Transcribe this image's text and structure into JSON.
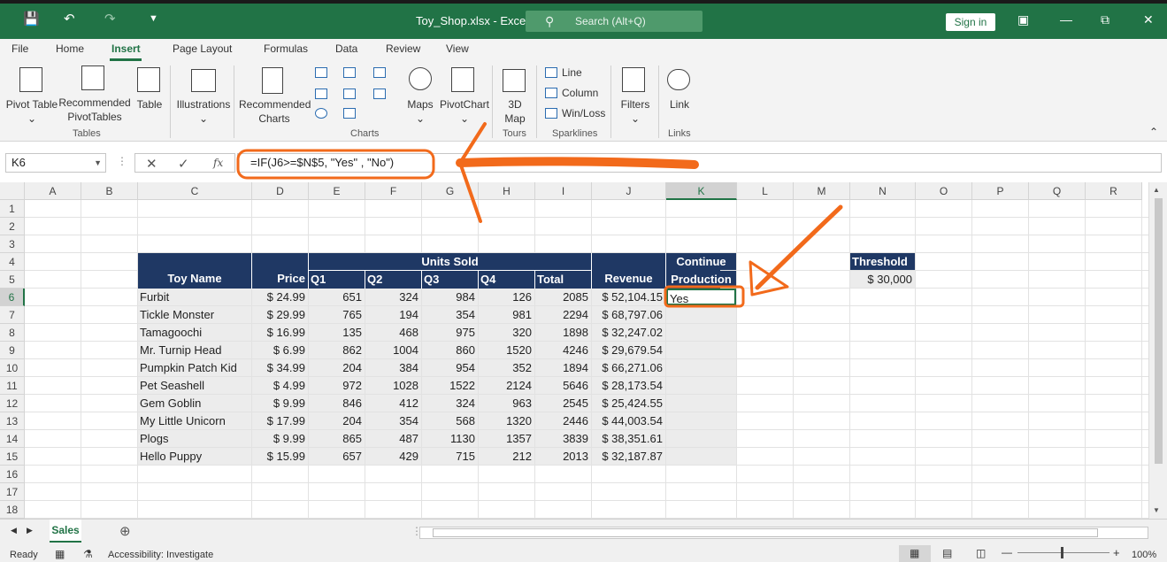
{
  "window": {
    "title": "Toy_Shop.xlsx - Excel",
    "search_placeholder": "Search (Alt+Q)",
    "signin": "Sign in"
  },
  "tabs": [
    "File",
    "Home",
    "Insert",
    "Page Layout",
    "Formulas",
    "Data",
    "Review",
    "View"
  ],
  "active_tab": "Insert",
  "ribbon": {
    "pivot_table": "Pivot Table",
    "recommended_pivot_1": "Recommended",
    "recommended_pivot_2": "PivotTables",
    "table": "Table",
    "group_tables": "Tables",
    "illustrations": "Illustrations",
    "recommended_charts_1": "Recommended",
    "recommended_charts_2": "Charts",
    "maps": "Maps",
    "pivotchart": "PivotChart",
    "group_charts": "Charts",
    "map3d_1": "3D",
    "map3d_2": "Map",
    "group_tours": "Tours",
    "spark_line": "Line",
    "spark_column": "Column",
    "spark_winloss": "Win/Loss",
    "group_sparklines": "Sparklines",
    "filters": "Filters",
    "link": "Link",
    "group_links": "Links"
  },
  "formula_bar": {
    "name_box": "K6",
    "formula": "=IF(J6>=$N$5, \"Yes\" , \"No\")"
  },
  "columns": [
    "A",
    "B",
    "C",
    "D",
    "E",
    "F",
    "G",
    "H",
    "I",
    "J",
    "K",
    "L",
    "M",
    "N",
    "O",
    "P",
    "Q",
    "R"
  ],
  "rows": [
    "1",
    "2",
    "3",
    "4",
    "5",
    "6",
    "7",
    "8",
    "9",
    "10",
    "11",
    "12",
    "13",
    "14",
    "15",
    "16",
    "17",
    "18"
  ],
  "selected_col": "K",
  "selected_row": "6",
  "table": {
    "h_toy": "Toy Name",
    "h_price": "Price",
    "h_units": "Units Sold",
    "h_q1": "Q1",
    "h_q2": "Q2",
    "h_q3": "Q3",
    "h_q4": "Q4",
    "h_total": "Total",
    "h_revenue": "Revenue",
    "h_continue": "Continue",
    "h_production": "Production",
    "rows": [
      {
        "name": "Furbit",
        "price": "$ 24.99",
        "q1": "651",
        "q2": "324",
        "q3": "984",
        "q4": "126",
        "total": "2085",
        "revenue": "$ 52,104.15",
        "cont": "Yes"
      },
      {
        "name": "Tickle Monster",
        "price": "$ 29.99",
        "q1": "765",
        "q2": "194",
        "q3": "354",
        "q4": "981",
        "total": "2294",
        "revenue": "$ 68,797.06",
        "cont": ""
      },
      {
        "name": "Tamagoochi",
        "price": "$ 16.99",
        "q1": "135",
        "q2": "468",
        "q3": "975",
        "q4": "320",
        "total": "1898",
        "revenue": "$ 32,247.02",
        "cont": ""
      },
      {
        "name": "Mr. Turnip Head",
        "price": "$ 6.99",
        "q1": "862",
        "q2": "1004",
        "q3": "860",
        "q4": "1520",
        "total": "4246",
        "revenue": "$ 29,679.54",
        "cont": ""
      },
      {
        "name": "Pumpkin Patch Kid",
        "price": "$ 34.99",
        "q1": "204",
        "q2": "384",
        "q3": "954",
        "q4": "352",
        "total": "1894",
        "revenue": "$ 66,271.06",
        "cont": ""
      },
      {
        "name": "Pet Seashell",
        "price": "$ 4.99",
        "q1": "972",
        "q2": "1028",
        "q3": "1522",
        "q4": "2124",
        "total": "5646",
        "revenue": "$ 28,173.54",
        "cont": ""
      },
      {
        "name": "Gem Goblin",
        "price": "$ 9.99",
        "q1": "846",
        "q2": "412",
        "q3": "324",
        "q4": "963",
        "total": "2545",
        "revenue": "$ 25,424.55",
        "cont": ""
      },
      {
        "name": "My Little Unicorn",
        "price": "$ 17.99",
        "q1": "204",
        "q2": "354",
        "q3": "568",
        "q4": "1320",
        "total": "2446",
        "revenue": "$ 44,003.54",
        "cont": ""
      },
      {
        "name": "Plogs",
        "price": "$ 9.99",
        "q1": "865",
        "q2": "487",
        "q3": "1130",
        "q4": "1357",
        "total": "3839",
        "revenue": "$ 38,351.61",
        "cont": ""
      },
      {
        "name": "Hello Puppy",
        "price": "$ 15.99",
        "q1": "657",
        "q2": "429",
        "q3": "715",
        "q4": "212",
        "total": "2013",
        "revenue": "$ 32,187.87",
        "cont": ""
      }
    ]
  },
  "threshold": {
    "label": "Threshold",
    "value": "$ 30,000"
  },
  "sheet_tab": "Sales",
  "status": {
    "ready": "Ready",
    "accessibility": "Accessibility: Investigate",
    "zoom": "100%"
  },
  "colors": {
    "excel_green": "#217346",
    "header_navy": "#1f3864",
    "annotation": "#f26a1b"
  }
}
